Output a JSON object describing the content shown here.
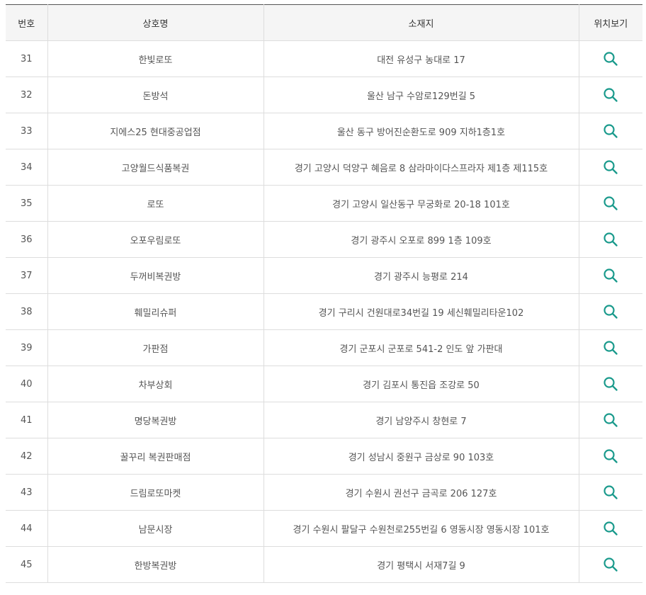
{
  "table": {
    "headers": {
      "number": "번호",
      "name": "상호명",
      "address": "소재지",
      "location": "위치보기"
    },
    "rows": [
      {
        "number": "31",
        "name": "한빛로또",
        "address": "대전 유성구 농대로 17"
      },
      {
        "number": "32",
        "name": "돈방석",
        "address": "울산 남구 수암로129번길 5"
      },
      {
        "number": "33",
        "name": "지에스25 현대중공업점",
        "address": "울산 동구 방어진순환도로 909 지하1층1호"
      },
      {
        "number": "34",
        "name": "고양월드식품복권",
        "address": "경기 고양시 덕양구 혜음로 8 삼라마이다스프라자 제1층 제115호"
      },
      {
        "number": "35",
        "name": "로또",
        "address": "경기 고양시 일산동구 무궁화로 20-18 101호"
      },
      {
        "number": "36",
        "name": "오포우림로또",
        "address": "경기 광주시 오포로 899 1층 109호"
      },
      {
        "number": "37",
        "name": "두꺼비복권방",
        "address": "경기 광주시 능평로 214"
      },
      {
        "number": "38",
        "name": "훼밀리슈퍼",
        "address": "경기 구리시 건원대로34번길 19 세신훼밀리타운102"
      },
      {
        "number": "39",
        "name": "가판점",
        "address": "경기 군포시 군포로 541-2 인도 앞 가판대"
      },
      {
        "number": "40",
        "name": "차부상회",
        "address": "경기 김포시 통진읍 조강로 50"
      },
      {
        "number": "41",
        "name": "명당복권방",
        "address": "경기 남양주시 창현로 7"
      },
      {
        "number": "42",
        "name": "꿀꾸리 복권판매점",
        "address": "경기 성남시 중원구 금상로 90 103호"
      },
      {
        "number": "43",
        "name": "드림로또마켓",
        "address": "경기 수원시 권선구 금곡로 206 127호"
      },
      {
        "number": "44",
        "name": "남문시장",
        "address": "경기 수원시 팔달구 수원천로255번길 6 영동시장 영동시장 101호"
      },
      {
        "number": "45",
        "name": "한방복권방",
        "address": "경기 평택시 서재7길 9"
      }
    ]
  },
  "icons": {
    "location": "search-icon"
  },
  "colors": {
    "header_background": "#f5f5f5",
    "top_border": "#555555",
    "row_border": "#dddddd",
    "text": "#555555",
    "icon_accent": "#1a9a8c"
  }
}
